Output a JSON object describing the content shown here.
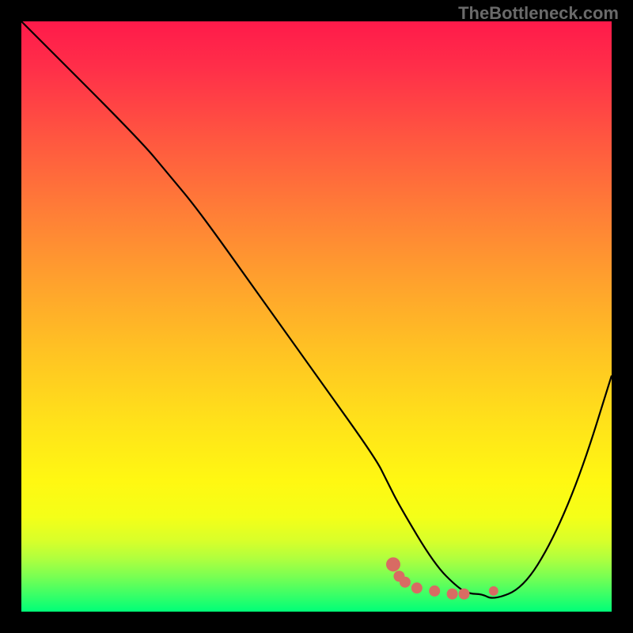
{
  "watermark": "TheBottleneck.com",
  "chart_data": {
    "type": "line",
    "title": "",
    "xlabel": "",
    "ylabel": "",
    "xlim": [
      0,
      100
    ],
    "ylim": [
      0,
      100
    ],
    "series": [
      {
        "name": "bottleneck-curve",
        "x": [
          0,
          20,
          25,
          30,
          40,
          50,
          60,
          62,
          64,
          70,
          74,
          76,
          78,
          80,
          85,
          90,
          95,
          100
        ],
        "values": [
          100,
          80,
          74,
          68,
          54,
          40,
          26,
          22,
          18,
          8,
          4,
          3,
          3,
          2,
          4,
          12,
          24,
          40
        ]
      }
    ],
    "markers": {
      "name": "highlight-points",
      "color": "#d86b63",
      "points": [
        {
          "x": 63,
          "y": 8
        },
        {
          "x": 64,
          "y": 6
        },
        {
          "x": 65,
          "y": 5
        },
        {
          "x": 67,
          "y": 4
        },
        {
          "x": 70,
          "y": 3.5
        },
        {
          "x": 73,
          "y": 3
        },
        {
          "x": 75,
          "y": 3
        },
        {
          "x": 80,
          "y": 3.5
        }
      ]
    },
    "gradient_stops": [
      {
        "pos": 0,
        "color": "#ff1a4a"
      },
      {
        "pos": 50,
        "color": "#ffc323"
      },
      {
        "pos": 85,
        "color": "#f4ff18"
      },
      {
        "pos": 100,
        "color": "#00ff78"
      }
    ]
  }
}
